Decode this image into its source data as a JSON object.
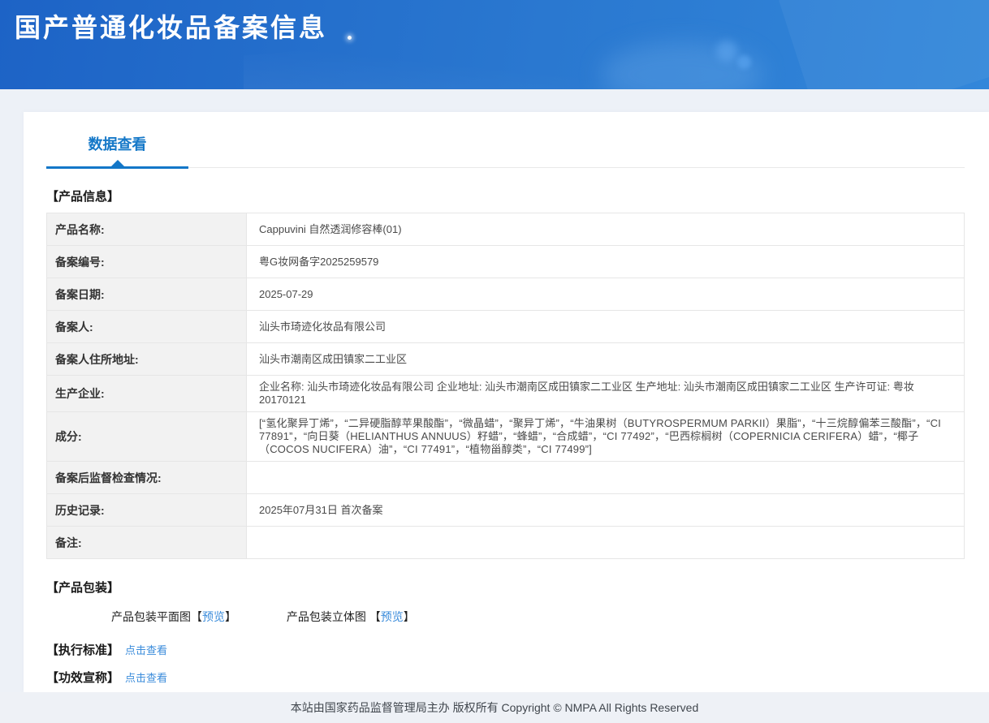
{
  "header": {
    "title": "国产普通化妆品备案信息"
  },
  "tabs": {
    "data_view": "数据查看"
  },
  "product_info": {
    "heading": "【产品信息】",
    "rows": [
      {
        "label": "产品名称:",
        "value": "Cappuvini 自然透润修容棒(01)"
      },
      {
        "label": "备案编号:",
        "value": "粤G妆网备字2025259579"
      },
      {
        "label": "备案日期:",
        "value": "2025-07-29"
      },
      {
        "label": "备案人:",
        "value": "汕头市琦迹化妆品有限公司"
      },
      {
        "label": "备案人住所地址:",
        "value": "汕头市潮南区成田镇家二工业区"
      },
      {
        "label": "生产企业:",
        "value": "企业名称: 汕头市琦迹化妆品有限公司 企业地址: 汕头市潮南区成田镇家二工业区 生产地址: 汕头市潮南区成田镇家二工业区 生产许可证: 粤妆20170121"
      },
      {
        "label": "成分:",
        "value": "[“氢化聚异丁烯”，“二异硬脂醇苹果酸酯”，“微晶蜡”，“聚异丁烯”，“牛油果树（BUTYROSPERMUM PARKII）果脂”，“十三烷醇偏苯三酸酯”，“CI 77891”，“向日葵（HELIANTHUS ANNUUS）籽蜡”，“蜂蜡”，“合成蜡”，“CI 77492”，“巴西棕榈树（COPERNICIA CERIFERA）蜡”，“椰子（COCOS NUCIFERA）油”，“CI 77491”，“植物甾醇类”，“CI 77499”]"
      },
      {
        "label": "备案后监督检查情况:",
        "value": ""
      },
      {
        "label": "历史记录:",
        "value": "2025年07月31日 首次备案"
      },
      {
        "label": "备注:",
        "value": ""
      }
    ]
  },
  "packaging": {
    "heading": "【产品包装】",
    "items": [
      {
        "prefix": "产品包装平面图【",
        "link": "预览",
        "suffix": "】"
      },
      {
        "prefix": "产品包装立体图 【",
        "link": "预览",
        "suffix": "】"
      }
    ]
  },
  "standards": {
    "heading": "【执行标准】",
    "link": "点击查看"
  },
  "claims": {
    "heading": "【功效宣称】",
    "link": "点击查看"
  },
  "footer": {
    "text": "本站由国家药品监督管理局主办 版权所有 Copyright © NMPA All Rights Reserved"
  },
  "colors": {
    "accent_blue": "#1578c8",
    "link_blue": "#3b8cdb",
    "header_gradient_start": "#1d63c6",
    "header_gradient_end": "#3287da",
    "label_cell_bg": "#f2f2f2",
    "page_bg": "#edf1f7"
  }
}
